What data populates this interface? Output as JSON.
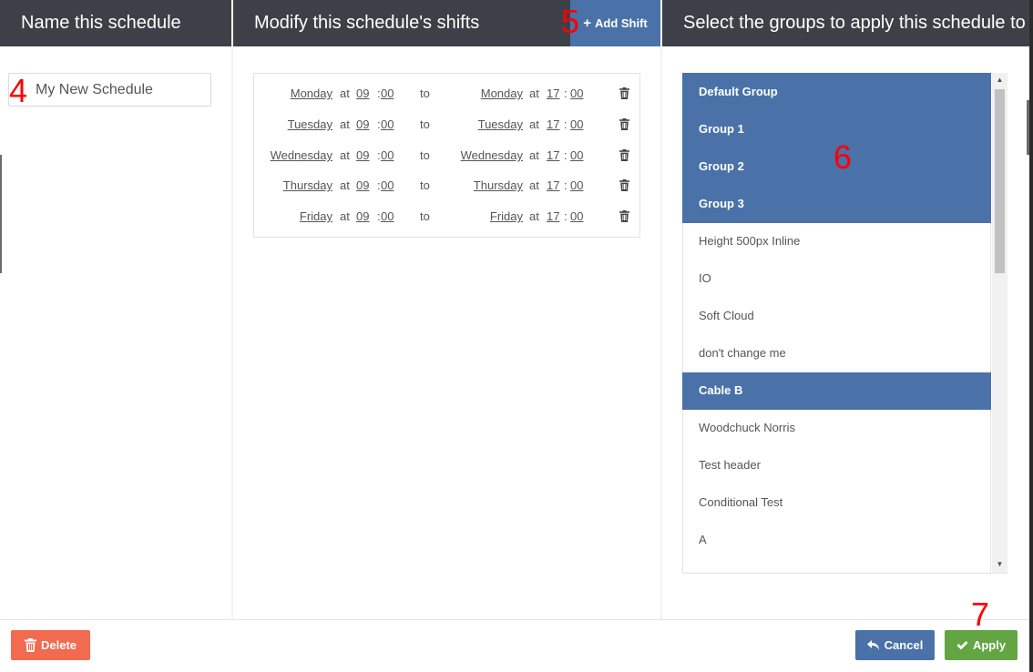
{
  "columns": {
    "name": {
      "title": "Name this schedule"
    },
    "shifts": {
      "title": "Modify this schedule's shifts",
      "add_shift_label": "Add Shift"
    },
    "groups": {
      "title": "Select the groups to apply this schedule to"
    }
  },
  "schedule_name": {
    "value": "My New Schedule"
  },
  "shifts": [
    {
      "start_day": "Monday",
      "at": "at",
      "start_hour": "09",
      "start_min": "00",
      "to": "to",
      "end_day": "Monday",
      "end_hour": "17",
      "end_min": "00"
    },
    {
      "start_day": "Tuesday",
      "at": "at",
      "start_hour": "09",
      "start_min": "00",
      "to": "to",
      "end_day": "Tuesday",
      "end_hour": "17",
      "end_min": "00"
    },
    {
      "start_day": "Wednesday",
      "at": "at",
      "start_hour": "09",
      "start_min": "00",
      "to": "to",
      "end_day": "Wednesday",
      "end_hour": "17",
      "end_min": "00"
    },
    {
      "start_day": "Thursday",
      "at": "at",
      "start_hour": "09",
      "start_min": "00",
      "to": "to",
      "end_day": "Thursday",
      "end_hour": "17",
      "end_min": "00"
    },
    {
      "start_day": "Friday",
      "at": "at",
      "start_hour": "09",
      "start_min": "00",
      "to": "to",
      "end_day": "Friday",
      "end_hour": "17",
      "end_min": "00"
    }
  ],
  "time_separator": ":",
  "groups": [
    {
      "label": "Default Group",
      "selected": true
    },
    {
      "label": "Group 1",
      "selected": true
    },
    {
      "label": "Group 2",
      "selected": true
    },
    {
      "label": "Group 3",
      "selected": true
    },
    {
      "label": "Height 500px Inline",
      "selected": false
    },
    {
      "label": "IO",
      "selected": false
    },
    {
      "label": "Soft Cloud",
      "selected": false
    },
    {
      "label": "don't change me",
      "selected": false
    },
    {
      "label": "Cable B",
      "selected": true
    },
    {
      "label": "Woodchuck Norris",
      "selected": false
    },
    {
      "label": "Test header",
      "selected": false
    },
    {
      "label": "Conditional Test",
      "selected": false
    },
    {
      "label": "A",
      "selected": false
    },
    {
      "label": "",
      "selected": false
    }
  ],
  "footer": {
    "delete_label": "Delete",
    "cancel_label": "Cancel",
    "apply_label": "Apply"
  },
  "annotations": {
    "a4": "4",
    "a5": "5",
    "a6": "6",
    "a7": "7"
  },
  "colors": {
    "header_bg": "#3d4147",
    "accent_blue": "#4a72a8",
    "delete_red": "#f26a4f",
    "apply_green": "#64a543",
    "annotation_red": "#ff0000"
  },
  "icons": {
    "add": "plus-icon",
    "trash": "trash-icon",
    "cancel": "undo-icon",
    "apply": "check-icon",
    "scroll_up": "caret-up-icon",
    "scroll_down": "caret-down-icon"
  }
}
